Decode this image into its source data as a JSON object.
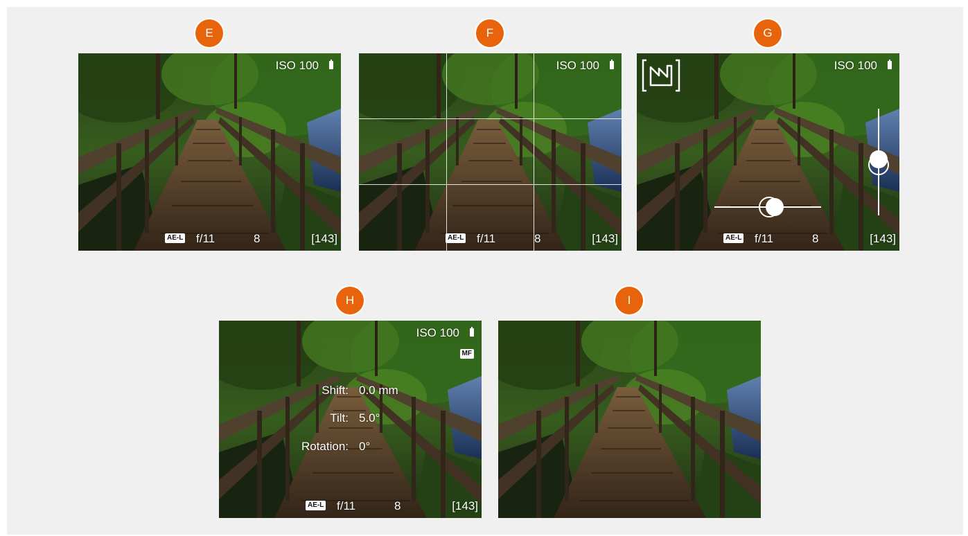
{
  "badges": {
    "e": "E",
    "f": "F",
    "g": "G",
    "h": "H",
    "i": "I"
  },
  "osd": {
    "iso": "ISO 100",
    "ae_lock": "AE-L",
    "aperture": "f/11",
    "shots": "8",
    "remaining": "[143]",
    "focus_mode": "MF"
  },
  "tilt_shift": {
    "shift_label": "Shift:",
    "shift_value": "0.0 mm",
    "tilt_label": "Tilt:",
    "tilt_value": "5.0°",
    "rotation_label": "Rotation:",
    "rotation_value": "0°"
  },
  "level_indicator": {
    "horizontal_level": 0.53,
    "vertical_level": 0.5
  },
  "icons": [
    "battery-icon",
    "photo-style-icon"
  ],
  "colors": {
    "badge": "#e8640c",
    "canvas": "#f0f0f0"
  }
}
